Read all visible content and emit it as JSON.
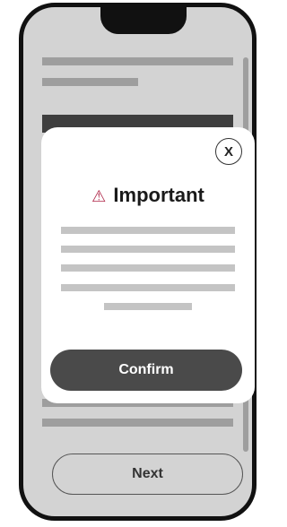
{
  "modal": {
    "close_label": "X",
    "warning_icon": "⚠",
    "title": "Important",
    "confirm_label": "Confirm"
  },
  "background": {
    "next_label": "Next"
  },
  "colors": {
    "phone_frame": "#111111",
    "screen": "#d3d3d3",
    "placeholder": "#9e9e9e",
    "primary_button": "#4a4a4a",
    "warning_icon": "#b0284a"
  }
}
